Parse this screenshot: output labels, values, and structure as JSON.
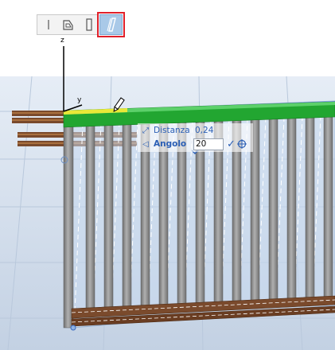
{
  "palette": {
    "buttons": [
      {
        "name": "Linea",
        "icon": "line-icon"
      },
      {
        "name": "Forma",
        "icon": "shape-icon"
      },
      {
        "name": "Rettangolo",
        "icon": "rect-icon"
      },
      {
        "name": "Inclina",
        "icon": "slant-icon",
        "active": true
      }
    ]
  },
  "axes": {
    "y_label": "y",
    "z_label": "z"
  },
  "tracker": {
    "distance_label": "Distanza",
    "distance_value": "0,24",
    "angle_label": "Angolo",
    "angle_value": "20"
  },
  "colors": {
    "sky": "#dfe8f4",
    "floor": "#cdd9e8",
    "post": "#8e8e8e",
    "top_rail": "#22a631",
    "rail_brown": "#7a4a2c",
    "accent_blue": "#2b5fb5",
    "selection_red": "#e0202a"
  }
}
